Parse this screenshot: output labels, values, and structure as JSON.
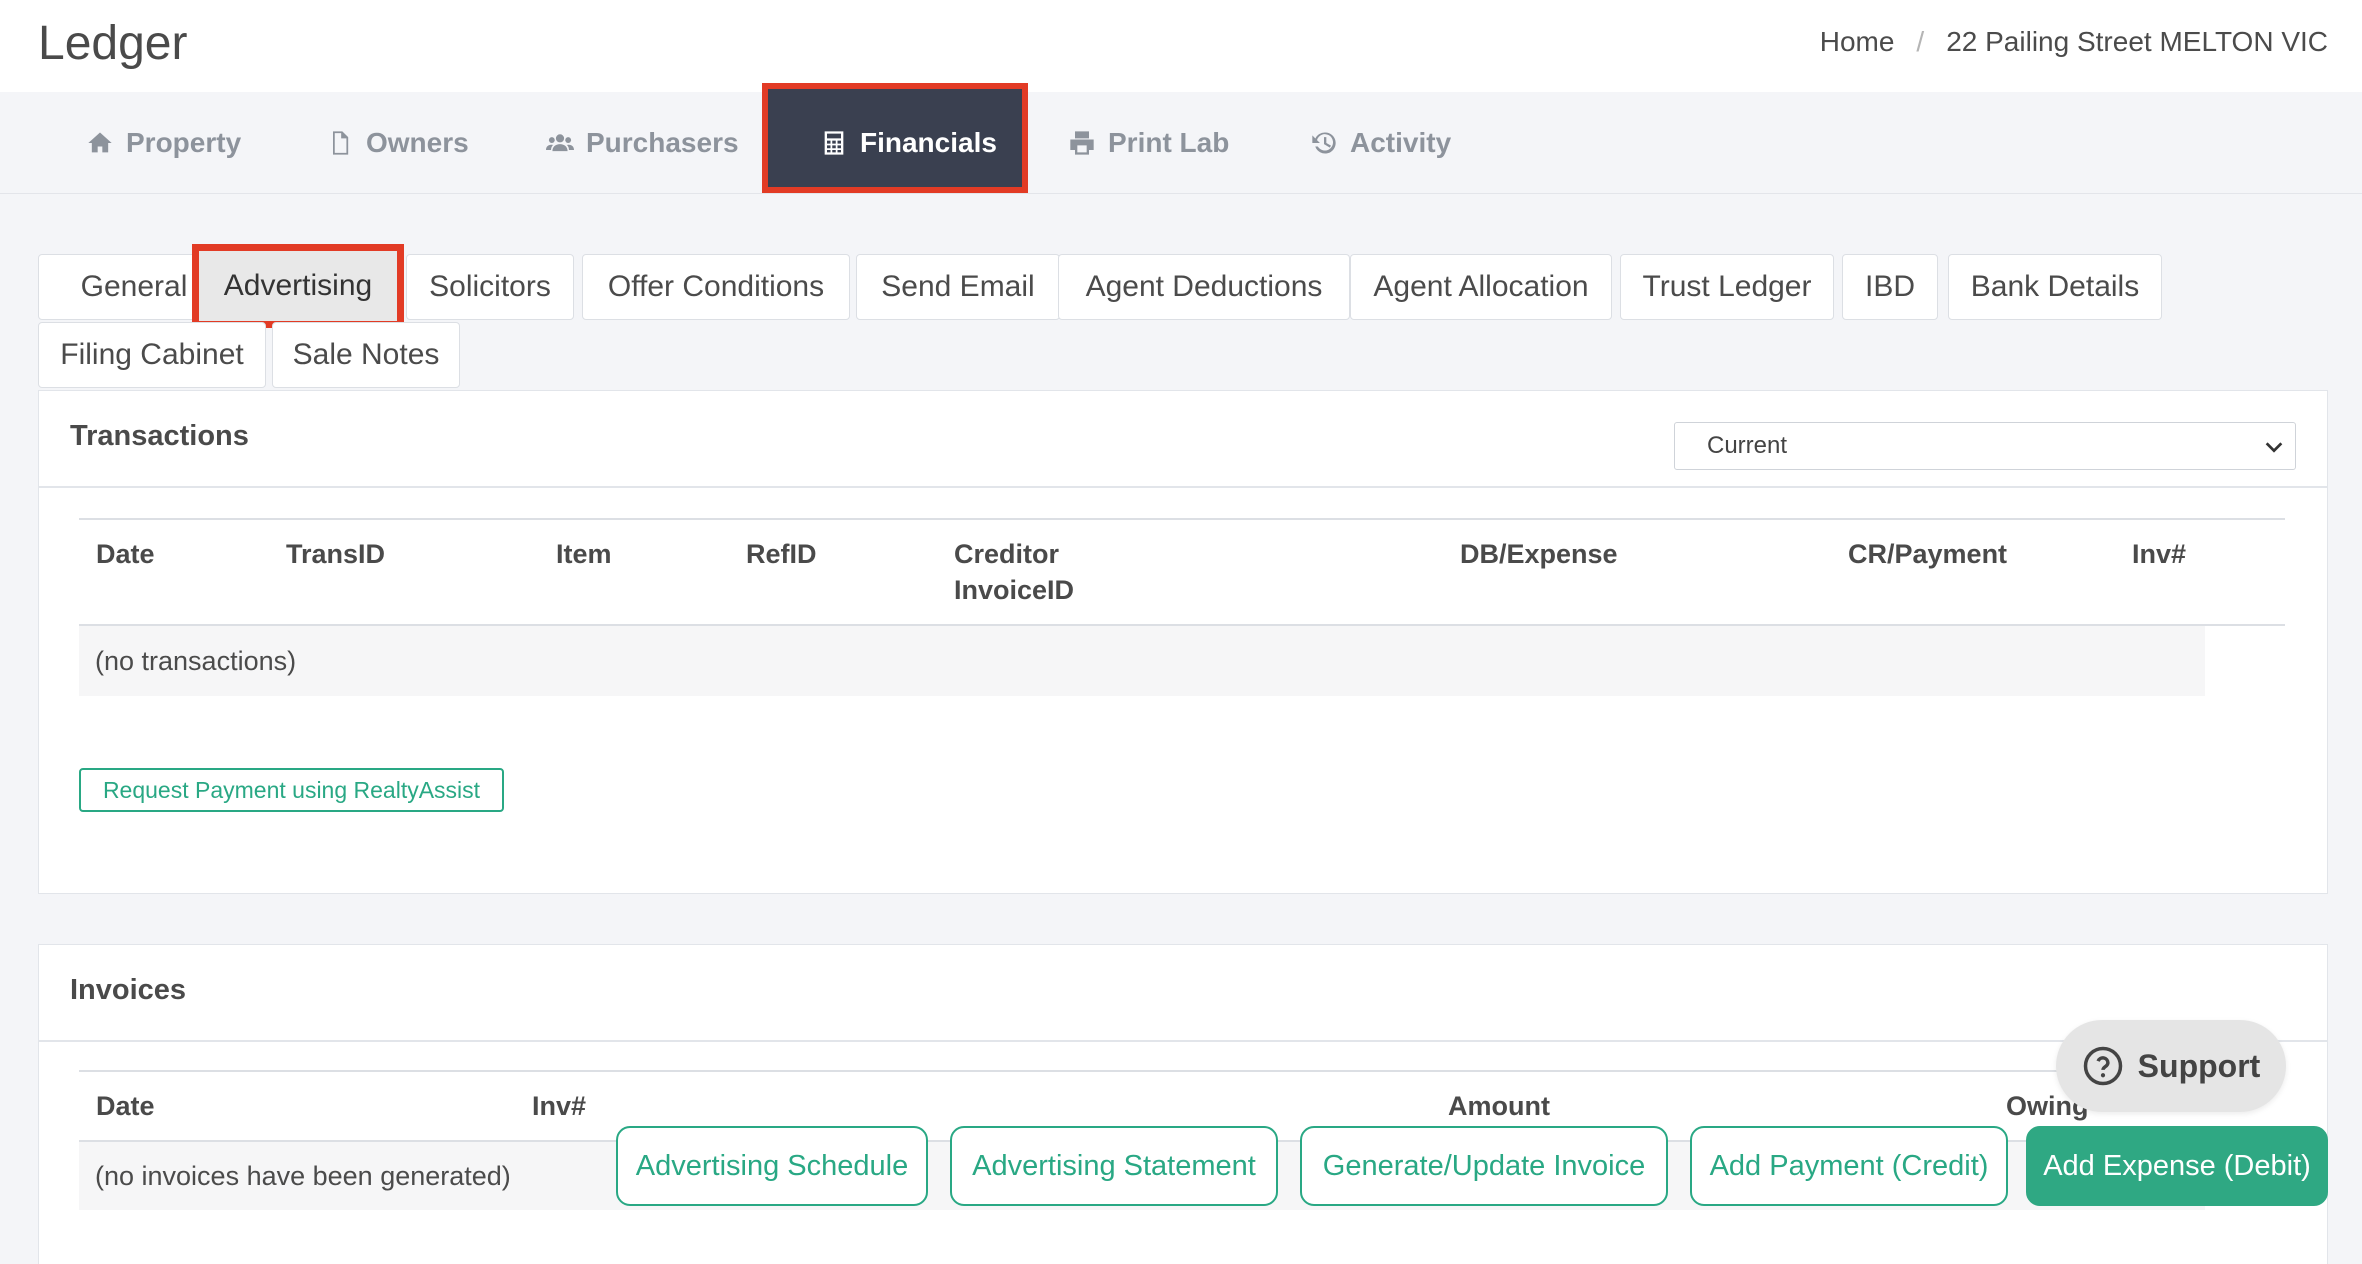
{
  "header": {
    "title": "Ledger",
    "breadcrumb": {
      "home": "Home",
      "separator": "/",
      "current": "22 Pailing Street MELTON VIC"
    }
  },
  "nav": {
    "items": [
      {
        "label": "Property",
        "icon": "home-icon"
      },
      {
        "label": "Owners",
        "icon": "file-icon"
      },
      {
        "label": "Purchasers",
        "icon": "users-icon"
      },
      {
        "label": "Financials",
        "icon": "calculator-icon",
        "active": true
      },
      {
        "label": "Print Lab",
        "icon": "print-icon"
      },
      {
        "label": "Activity",
        "icon": "history-icon"
      }
    ]
  },
  "subtabs": {
    "items": [
      "General",
      "Advertising",
      "Solicitors",
      "Offer Conditions",
      "Send Email",
      "Agent Deductions",
      "Agent Allocation",
      "Trust Ledger",
      "IBD",
      "Bank Details",
      "Filing Cabinet",
      "Sale Notes"
    ],
    "active": "Advertising"
  },
  "transactions": {
    "title": "Transactions",
    "filter": {
      "selected": "Current"
    },
    "columns": [
      "Date",
      "TransID",
      "Item",
      "RefID",
      "Creditor",
      "InvoiceID",
      "DB/Expense",
      "CR/Payment",
      "Inv#"
    ],
    "empty_text": "(no transactions)",
    "request_button": "Request Payment using RealtyAssist"
  },
  "invoices": {
    "title": "Invoices",
    "columns": [
      "Date",
      "Inv#",
      "Amount",
      "Owing"
    ],
    "empty_text": "(no invoices have been generated)"
  },
  "actions": {
    "advertising_schedule": "Advertising Schedule",
    "advertising_statement": "Advertising Statement",
    "generate_invoice": "Generate/Update Invoice",
    "add_payment": "Add Payment (Credit)",
    "add_expense": "Add Expense (Debit)"
  },
  "support": {
    "label": "Support",
    "icon": "question-circle-icon"
  },
  "colors": {
    "accent_green": "#29a884",
    "nav_active_bg": "#3a4050",
    "highlight_red": "#e23b25"
  }
}
